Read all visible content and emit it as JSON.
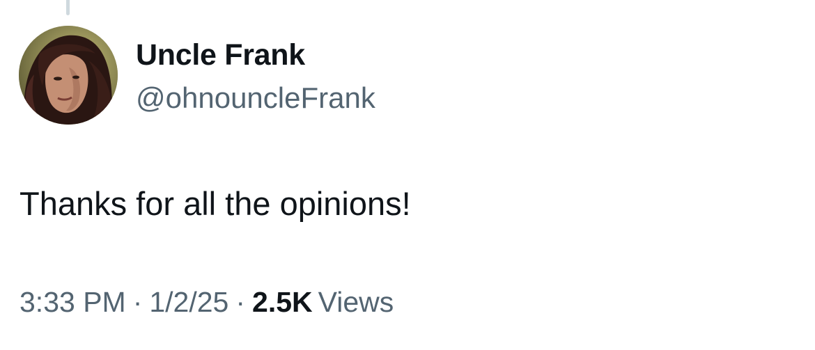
{
  "tweet": {
    "author": {
      "display_name": "Uncle Frank",
      "handle": "@ohnouncleFrank",
      "avatar_icon": "profile-photo"
    },
    "text": "Thanks for all the opinions!",
    "meta": {
      "time": "3:33 PM",
      "separator": "·",
      "date": "1/2/25",
      "views_count": "2.5K",
      "views_label": "Views"
    }
  },
  "colors": {
    "primary_text": "#0f1419",
    "secondary_text": "#536471",
    "thread_line": "#cfd9de",
    "background": "#ffffff"
  }
}
